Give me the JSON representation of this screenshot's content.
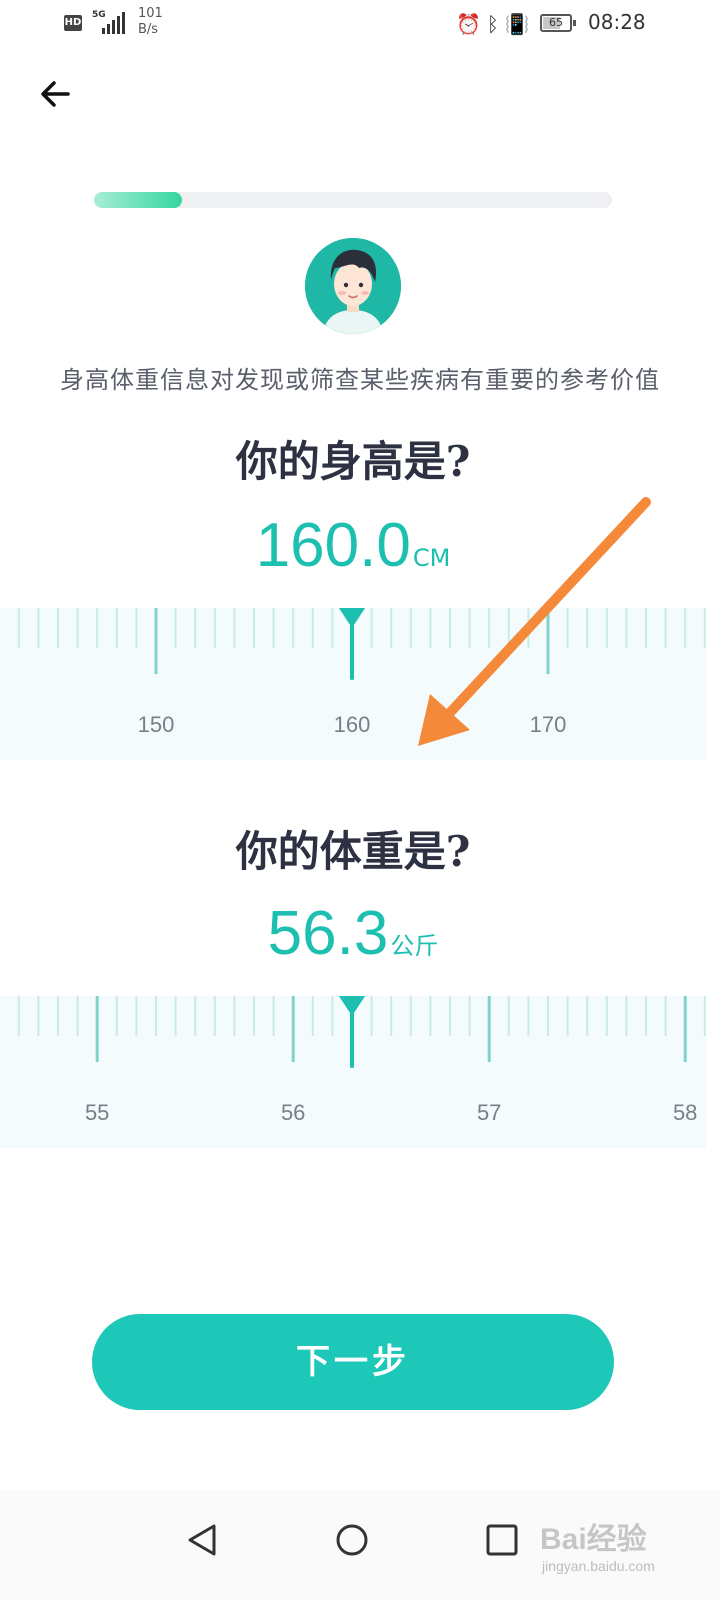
{
  "status_bar": {
    "hd": "HD",
    "network": "5G",
    "net_speed_value": "101",
    "net_speed_unit": "B/s",
    "battery": "65",
    "battery_level": 0.65,
    "time": "08:28"
  },
  "progress": {
    "value": 0.17
  },
  "subtitle": "身高体重信息对发现或筛查某些疾病有重要的参考价值",
  "height": {
    "question": "你的身高是?",
    "value": "160.0",
    "unit": "CM",
    "current": 160.0,
    "labels": [
      "150",
      "160",
      "170"
    ]
  },
  "weight": {
    "question": "你的体重是?",
    "value": "56.3",
    "unit": "公斤",
    "current": 56.3,
    "labels": [
      "55",
      "56",
      "57",
      "58"
    ]
  },
  "next_button": "下一步",
  "watermark": {
    "logo": "Bai经验",
    "sub": "jingyan.baidu.com"
  },
  "colors": {
    "accent": "#1ec8b8",
    "arrow": "#f5893a"
  }
}
